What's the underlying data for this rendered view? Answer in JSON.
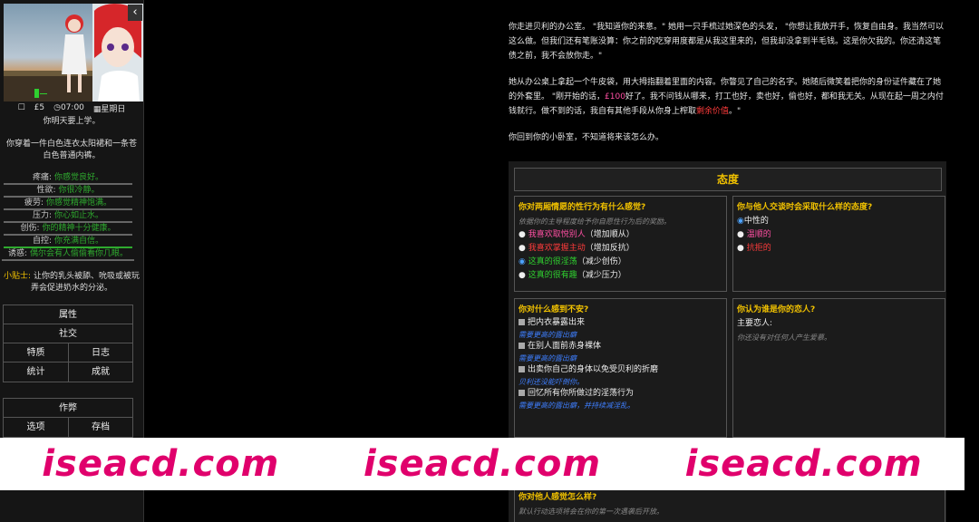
{
  "sidebar": {
    "collapse_glyph": "‹",
    "status": {
      "money": "£5",
      "time": "07:00",
      "day": "星期日"
    },
    "status_icons": [
      "calendar-icon",
      "clock-icon",
      "grid-icon"
    ],
    "line1": "你明天要上学。",
    "line2": "你穿着一件白色连衣太阳裙和一条苍白色普通内裤。",
    "stats": [
      {
        "label": "疼痛:",
        "value": "你感觉良好。"
      },
      {
        "label": "性欲:",
        "value": "你很冷静。"
      },
      {
        "label": "疲劳:",
        "value": "你感觉精神饱满。"
      },
      {
        "label": "压力:",
        "value": "你心如止水。"
      },
      {
        "label": "创伤:",
        "value": "你的精神十分健康。"
      },
      {
        "label": "自控:",
        "value": "你充满自信。"
      },
      {
        "label": "诱惑:",
        "value": "偶尔会有人偷偷看你几眼。"
      }
    ],
    "tip_label": "小贴士:",
    "tip_text": "让你的乳头被舔、吮吸或被玩弄会促进奶水的分泌。",
    "menu1": {
      "attributes": "属性",
      "social": "社交",
      "traits": "特质",
      "journal": "日志",
      "stats": "统计",
      "achievements": "成就"
    },
    "menu2": {
      "cheats": "作弊",
      "options": "选项",
      "saves": "存档"
    }
  },
  "main": {
    "p1": "你走进贝利的办公室。 \"我知道你的来意。\" 她用一只手梳过她深色的头发， \"你想让我放开手，恢复自由身。我当然可以这么做。但我们还有笔账没算：你之前的吃穿用度都是从我这里来的，但我却没拿到半毛钱。这是你欠我的。你还清这笔债之前，我不会放你走。\"",
    "p2_a": "她从办公桌上拿起一个牛皮袋，用大拇指翻着里面的内容。你瞥见了自己的名字。她随后微笑着把你的身份证件藏在了她的外套里。 \"刚开始的话，",
    "p2_money": "£100",
    "p2_b": "好了。我不问钱从哪来，打工也好，卖也好，偷也好，都和我无关。从现在起一周之内付钱就行。做不到的话，我自有其他手段从你身上榨取",
    "p2_value": "剩余价值",
    "p2_c": "。\"",
    "p3": "你回到你的小卧室，不知道将来该怎么办。"
  },
  "attitude": {
    "title": "态度",
    "q1": "你对两厢情愿的性行为有什么感觉?",
    "q1_hint": "依据你的主导程度给予你自愿性行为后的奖励。",
    "q1_options": [
      {
        "text": "我喜欢取悦别人",
        "effect": "（增加顺从）"
      },
      {
        "text": "我喜欢掌握主动",
        "effect": "（增加反抗）"
      },
      {
        "text": "这真的很淫荡",
        "effect": "（减少创伤）"
      },
      {
        "text": "这真的很有趣",
        "effect": "（减少压力）"
      }
    ],
    "q2": "你与他人交谈时会采取什么样的态度?",
    "q2_options": [
      "中性的",
      "温顺的",
      "抗拒的"
    ],
    "q3": "你对什么感到不安?",
    "q3_items": [
      {
        "text": "把内衣暴露出来",
        "note": "需要更高的露出癖"
      },
      {
        "text": "在别人面前赤身裸体",
        "note": "需要更高的露出癖"
      },
      {
        "text": "出卖你自己的身体以免受贝利的折磨",
        "note": "贝利还没能吓倒你。"
      },
      {
        "text": "回忆所有你所做过的淫荡行为",
        "note": "需要更高的露出癖，并持续减淫乱。"
      }
    ],
    "q4": "你认为谁是你的恋人?",
    "q4_label": "主要恋人:",
    "q4_note": "你还没有对任何人产生爱慕。",
    "q5": "你对他人感觉怎么样?",
    "q5_note": "默认行动选项将会在你的第一次遇袭后开放。"
  },
  "watermark": [
    "iseacd.com",
    "iseacd.com",
    "iseacd.com"
  ],
  "colors": {
    "accent_gold": "#f2c200",
    "positive_green": "#2faa2f",
    "pink": "#ff4fa3",
    "watermark": "#e0006c"
  }
}
